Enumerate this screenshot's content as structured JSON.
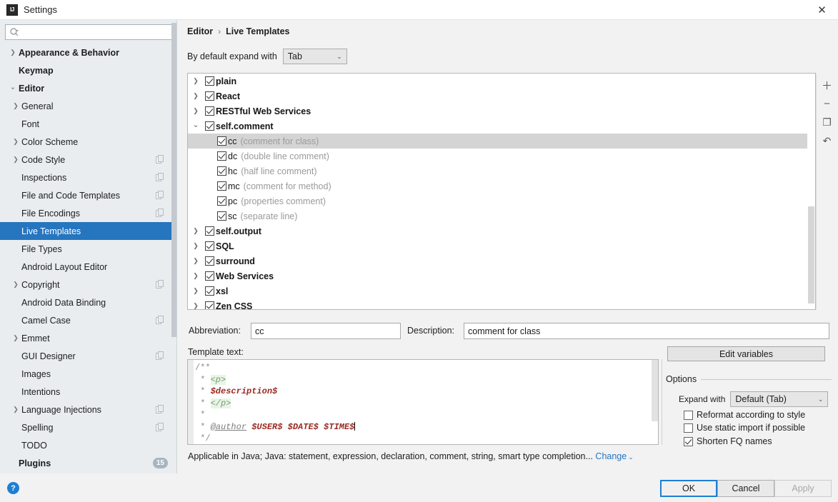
{
  "window": {
    "title": "Settings",
    "app_icon": "intellij-idea-icon",
    "close_label": "✕"
  },
  "sidebar": {
    "search": {
      "placeholder": "",
      "value": "",
      "icon": "search-icon"
    },
    "items": [
      {
        "label": "Appearance & Behavior",
        "arrow": true,
        "bold": true,
        "indent": 0,
        "selected": false,
        "copy": false
      },
      {
        "label": "Keymap",
        "arrow": false,
        "bold": true,
        "indent": 0,
        "selected": false,
        "copy": false
      },
      {
        "label": "Editor",
        "arrow": true,
        "expanded": true,
        "bold": true,
        "indent": 0,
        "selected": false,
        "copy": false
      },
      {
        "label": "General",
        "arrow": true,
        "bold": false,
        "indent": 1,
        "selected": false,
        "copy": false
      },
      {
        "label": "Font",
        "arrow": false,
        "bold": false,
        "indent": 1,
        "selected": false,
        "copy": false
      },
      {
        "label": "Color Scheme",
        "arrow": true,
        "bold": false,
        "indent": 1,
        "selected": false,
        "copy": false
      },
      {
        "label": "Code Style",
        "arrow": true,
        "bold": false,
        "indent": 1,
        "selected": false,
        "copy": true
      },
      {
        "label": "Inspections",
        "arrow": false,
        "bold": false,
        "indent": 1,
        "selected": false,
        "copy": true
      },
      {
        "label": "File and Code Templates",
        "arrow": false,
        "bold": false,
        "indent": 1,
        "selected": false,
        "copy": true
      },
      {
        "label": "File Encodings",
        "arrow": false,
        "bold": false,
        "indent": 1,
        "selected": false,
        "copy": true
      },
      {
        "label": "Live Templates",
        "arrow": false,
        "bold": false,
        "indent": 1,
        "selected": true,
        "copy": false
      },
      {
        "label": "File Types",
        "arrow": false,
        "bold": false,
        "indent": 1,
        "selected": false,
        "copy": false
      },
      {
        "label": "Android Layout Editor",
        "arrow": false,
        "bold": false,
        "indent": 1,
        "selected": false,
        "copy": false
      },
      {
        "label": "Copyright",
        "arrow": true,
        "bold": false,
        "indent": 1,
        "selected": false,
        "copy": true
      },
      {
        "label": "Android Data Binding",
        "arrow": false,
        "bold": false,
        "indent": 1,
        "selected": false,
        "copy": false
      },
      {
        "label": "Camel Case",
        "arrow": false,
        "bold": false,
        "indent": 1,
        "selected": false,
        "copy": true
      },
      {
        "label": "Emmet",
        "arrow": true,
        "bold": false,
        "indent": 1,
        "selected": false,
        "copy": false
      },
      {
        "label": "GUI Designer",
        "arrow": false,
        "bold": false,
        "indent": 1,
        "selected": false,
        "copy": true
      },
      {
        "label": "Images",
        "arrow": false,
        "bold": false,
        "indent": 1,
        "selected": false,
        "copy": false
      },
      {
        "label": "Intentions",
        "arrow": false,
        "bold": false,
        "indent": 1,
        "selected": false,
        "copy": false
      },
      {
        "label": "Language Injections",
        "arrow": true,
        "bold": false,
        "indent": 1,
        "selected": false,
        "copy": true
      },
      {
        "label": "Spelling",
        "arrow": false,
        "bold": false,
        "indent": 1,
        "selected": false,
        "copy": true
      },
      {
        "label": "TODO",
        "arrow": false,
        "bold": false,
        "indent": 1,
        "selected": false,
        "copy": false
      },
      {
        "label": "Plugins",
        "arrow": false,
        "bold": true,
        "indent": 0,
        "selected": false,
        "copy": false,
        "badge": "15"
      }
    ]
  },
  "breadcrumb": {
    "root": "Editor",
    "separator": "›",
    "current": "Live Templates"
  },
  "expand_default": {
    "label": "By default expand with",
    "value": "Tab",
    "chevron": "⌄"
  },
  "templates_tree": {
    "rows": [
      {
        "name": "plain",
        "desc": "",
        "group": true,
        "expanded": false,
        "checked": true,
        "selected": false
      },
      {
        "name": "React",
        "desc": "",
        "group": true,
        "expanded": false,
        "checked": true,
        "selected": false
      },
      {
        "name": "RESTful Web Services",
        "desc": "",
        "group": true,
        "expanded": false,
        "checked": true,
        "selected": false
      },
      {
        "name": "self.comment",
        "desc": "",
        "group": true,
        "expanded": true,
        "checked": true,
        "selected": false
      },
      {
        "name": "cc",
        "desc": "(comment for class)",
        "group": false,
        "checked": true,
        "selected": true
      },
      {
        "name": "dc",
        "desc": "(double line comment)",
        "group": false,
        "checked": true,
        "selected": false
      },
      {
        "name": "hc",
        "desc": "(half line comment)",
        "group": false,
        "checked": true,
        "selected": false
      },
      {
        "name": "mc",
        "desc": "(comment for method)",
        "group": false,
        "checked": true,
        "selected": false
      },
      {
        "name": "pc",
        "desc": "(properties comment)",
        "group": false,
        "checked": true,
        "selected": false
      },
      {
        "name": "sc",
        "desc": "(separate line)",
        "group": false,
        "checked": true,
        "selected": false
      },
      {
        "name": "self.output",
        "desc": "",
        "group": true,
        "expanded": false,
        "checked": true,
        "selected": false
      },
      {
        "name": "SQL",
        "desc": "",
        "group": true,
        "expanded": false,
        "checked": true,
        "selected": false
      },
      {
        "name": "surround",
        "desc": "",
        "group": true,
        "expanded": false,
        "checked": true,
        "selected": false
      },
      {
        "name": "Web Services",
        "desc": "",
        "group": true,
        "expanded": false,
        "checked": true,
        "selected": false
      },
      {
        "name": "xsl",
        "desc": "",
        "group": true,
        "expanded": false,
        "checked": true,
        "selected": false
      },
      {
        "name": "Zen CSS",
        "desc": "",
        "group": true,
        "expanded": false,
        "checked": true,
        "selected": false
      }
    ],
    "toolbar": [
      {
        "icon": "plus-icon",
        "glyph": "＋"
      },
      {
        "icon": "minus-icon",
        "glyph": "−"
      },
      {
        "icon": "duplicate-icon",
        "glyph": "❐"
      },
      {
        "icon": "revert-icon",
        "glyph": "↶"
      }
    ]
  },
  "fields": {
    "abbreviation_label": "Abbreviation:",
    "abbreviation_value": "cc",
    "description_label": "Description:",
    "description_value": "comment for class",
    "template_text_label": "Template text:"
  },
  "template_text": {
    "lines": [
      "/**",
      " * <p>",
      " * $description$",
      " * </p>",
      " *",
      " * @author $USER$ $DATE$ $TIME$",
      " */"
    ]
  },
  "applicable": {
    "text": "Applicable in Java; Java: statement, expression, declaration, comment, string, smart type completion...",
    "change_label": "Change",
    "change_chevron": "⌄"
  },
  "options": {
    "edit_variables_label": "Edit variables",
    "title": "Options",
    "expand_with_label": "Expand with",
    "expand_with_value": "Default (Tab)",
    "chevron": "⌄",
    "checkboxes": [
      {
        "label": "Reformat according to style",
        "checked": false,
        "mnemonic": "R"
      },
      {
        "label": "Use static import if possible",
        "checked": false,
        "mnemonic": "i"
      },
      {
        "label": "Shorten FQ names",
        "checked": true,
        "mnemonic": "F"
      }
    ]
  },
  "dialog_buttons": {
    "ok": "OK",
    "cancel": "Cancel",
    "apply": "Apply"
  },
  "help": {
    "glyph": "?"
  },
  "colors": {
    "accent": "#2675bf",
    "selection_tree": "#d4d4d4",
    "sidebar_bg": "#e9edf0",
    "link": "#2575c2",
    "var_red": "#9b2b22",
    "tag_green": "#7d9a6e"
  }
}
